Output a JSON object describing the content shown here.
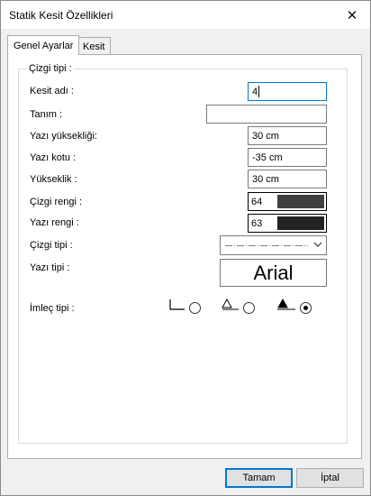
{
  "window": {
    "title": "Statik Kesit Özellikleri",
    "close_glyph": "✕"
  },
  "tabs": [
    {
      "label": "Genel Ayarlar",
      "active": true
    },
    {
      "label": "Kesit",
      "active": false
    }
  ],
  "group": {
    "label": "Çizgi tipi :"
  },
  "fields": {
    "kesit_adi": {
      "label": "Kesit adı :",
      "value": "4"
    },
    "tanim": {
      "label": "Tanım :",
      "value": ""
    },
    "yazi_yuksekligi": {
      "label": "Yazı yüksekliği:",
      "value": "30 cm"
    },
    "yazi_kotu": {
      "label": "Yazı kotu :",
      "value": "-35 cm"
    },
    "yukseklik": {
      "label": "Yükseklik :",
      "value": "30 cm"
    },
    "cizgi_rengi": {
      "label": "Çizgi rengi :",
      "value": "64",
      "color": "#404040"
    },
    "yazi_rengi": {
      "label": "Yazı rengi :",
      "value": "63",
      "color": "#232323"
    },
    "cizgi_tipi": {
      "label": "Çizgi tipi :"
    },
    "yazi_tipi": {
      "label": "Yazı tipi :",
      "value": "Arial"
    }
  },
  "imlec": {
    "label": "İmleç tipi :",
    "selected_index": 2
  },
  "buttons": {
    "ok": "Tamam",
    "cancel": "İptal"
  },
  "colors": {
    "accent": "#0078d7",
    "dialog_bg": "#f0f0f0"
  }
}
